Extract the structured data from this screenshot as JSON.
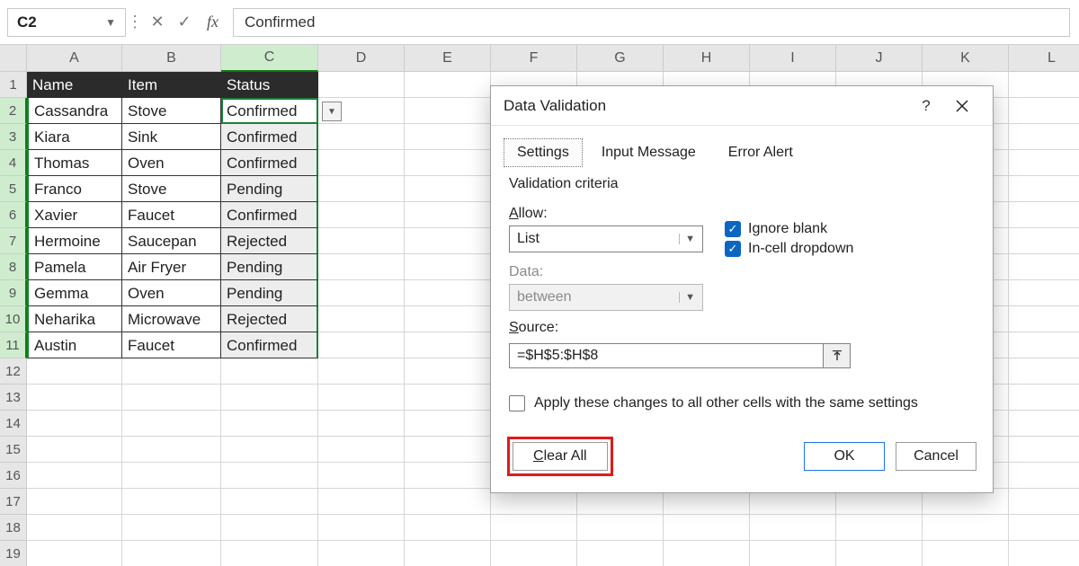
{
  "formula_bar": {
    "name_box": "C2",
    "cancel_glyph": "✕",
    "accept_glyph": "✓",
    "fx": "fx",
    "value": "Confirmed"
  },
  "columns": {
    "letters": [
      "A",
      "B",
      "C",
      "D",
      "E",
      "F",
      "G",
      "H",
      "I",
      "J",
      "K",
      "L"
    ],
    "widths": [
      106,
      110,
      108,
      96,
      96,
      96,
      96,
      96,
      96,
      96,
      96,
      96
    ],
    "active_index": 2
  },
  "rows": {
    "count": 19,
    "active": [
      2,
      3,
      4,
      5,
      6,
      7,
      8,
      9,
      10,
      11
    ]
  },
  "table": {
    "headers": [
      "Name",
      "Item",
      "Status"
    ],
    "data": [
      [
        "Cassandra",
        "Stove",
        "Confirmed"
      ],
      [
        "Kiara",
        "Sink",
        "Confirmed"
      ],
      [
        "Thomas",
        "Oven",
        "Confirmed"
      ],
      [
        "Franco",
        "Stove",
        "Pending"
      ],
      [
        "Xavier",
        "Faucet",
        "Confirmed"
      ],
      [
        "Hermoine",
        "Saucepan",
        "Rejected"
      ],
      [
        "Pamela",
        "Air Fryer",
        "Pending"
      ],
      [
        "Gemma",
        "Oven",
        "Pending"
      ],
      [
        "Neharika",
        "Microwave",
        "Rejected"
      ],
      [
        "Austin",
        "Faucet",
        "Confirmed"
      ]
    ]
  },
  "dialog": {
    "title": "Data Validation",
    "help": "?",
    "tabs": [
      "Settings",
      "Input Message",
      "Error Alert"
    ],
    "active_tab": 0,
    "criteria_label": "Validation criteria",
    "allow_label_pre": "A",
    "allow_label_post": "llow:",
    "allow_value": "List",
    "data_label": "Data:",
    "data_value": "between",
    "ignore_blank_pre": "Ignore ",
    "ignore_blank_u": "b",
    "ignore_blank_post": "lank",
    "incell_pre": "I",
    "incell_post": "n-cell dropdown",
    "source_label_pre": "S",
    "source_label_post": "ource:",
    "source_value": "=$H$5:$H$8",
    "apply_label": "Apply these changes to all other cells with the same settings",
    "clear_pre": "C",
    "clear_post": "lear All",
    "ok": "OK",
    "cancel": "Cancel"
  }
}
